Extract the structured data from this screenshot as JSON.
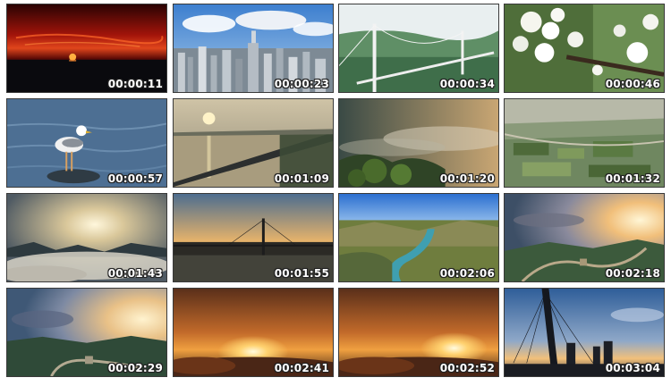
{
  "thumbnails": [
    {
      "timestamp": "00:00:11",
      "scene": "sunset-over-sea"
    },
    {
      "timestamp": "00:00:23",
      "scene": "city-skyline"
    },
    {
      "timestamp": "00:00:34",
      "scene": "suspension-bridge"
    },
    {
      "timestamp": "00:00:46",
      "scene": "white-blossoms"
    },
    {
      "timestamp": "00:00:57",
      "scene": "seagull-on-rock"
    },
    {
      "timestamp": "00:01:09",
      "scene": "river-bridge-sunrise"
    },
    {
      "timestamp": "00:01:20",
      "scene": "misty-valley"
    },
    {
      "timestamp": "00:01:32",
      "scene": "aerial-countryside"
    },
    {
      "timestamp": "00:01:43",
      "scene": "sea-of-clouds"
    },
    {
      "timestamp": "00:01:55",
      "scene": "cable-bridge-dusk"
    },
    {
      "timestamp": "00:02:06",
      "scene": "river-gorge"
    },
    {
      "timestamp": "00:02:18",
      "scene": "great-wall-sunset"
    },
    {
      "timestamp": "00:02:29",
      "scene": "great-wall-sunrise"
    },
    {
      "timestamp": "00:02:41",
      "scene": "sun-above-clouds"
    },
    {
      "timestamp": "00:02:52",
      "scene": "sun-above-clouds"
    },
    {
      "timestamp": "00:03:04",
      "scene": "cable-bridge-silhouette"
    }
  ]
}
